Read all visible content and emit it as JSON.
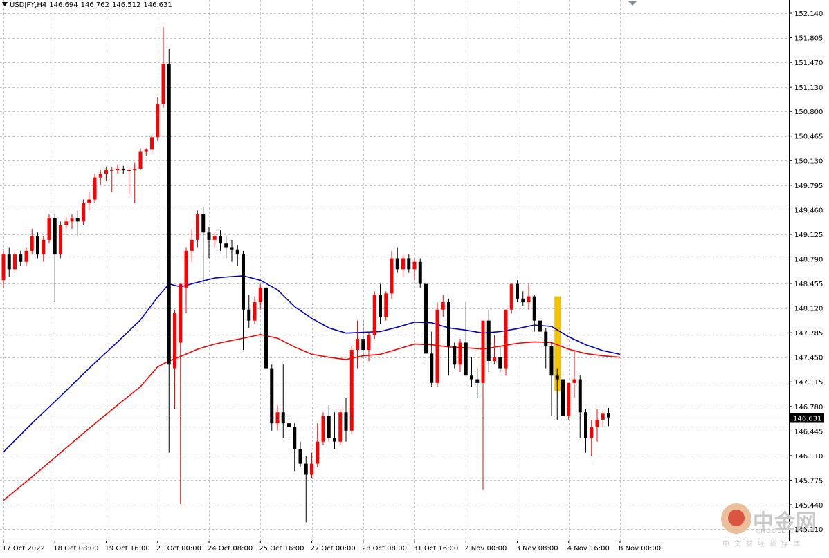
{
  "header": {
    "symbol": "USDJPY,H4",
    "open": "146.694",
    "high": "146.762",
    "low": "146.512",
    "close": "146.631"
  },
  "watermark": {
    "brand_cn": "中金网",
    "brand_en": "CNGOLD.COM",
    "tagline": "中文财经新媒体"
  },
  "chart_data": {
    "type": "candlestick",
    "symbol": "USDJPY",
    "timeframe": "H4",
    "y_range": [
      145.11,
      152.14
    ],
    "y_ticks": [
      "152.140",
      "151.805",
      "151.470",
      "151.130",
      "150.800",
      "150.465",
      "150.130",
      "149.795",
      "149.460",
      "149.125",
      "148.790",
      "148.455",
      "148.120",
      "147.785",
      "147.450",
      "147.115",
      "146.780",
      "146.445",
      "146.110",
      "145.775",
      "145.440",
      "145.110"
    ],
    "x_tick_labels": [
      {
        "bar": 0,
        "label": "17 Oct 2022"
      },
      {
        "bar": 9,
        "label": "18 Oct 08:00"
      },
      {
        "bar": 18,
        "label": "19 Oct 16:00"
      },
      {
        "bar": 27,
        "label": "21 Oct 00:00"
      },
      {
        "bar": 36,
        "label": "24 Oct 08:00"
      },
      {
        "bar": 45,
        "label": "25 Oct 16:00"
      },
      {
        "bar": 54,
        "label": "27 Oct 00:00"
      },
      {
        "bar": 63,
        "label": "28 Oct 08:00"
      },
      {
        "bar": 72,
        "label": "31 Oct 16:00"
      },
      {
        "bar": 81,
        "label": "2 Nov 00:00"
      },
      {
        "bar": 90,
        "label": "3 Nov 08:00"
      },
      {
        "bar": 99,
        "label": "4 Nov 16:00"
      },
      {
        "bar": 108,
        "label": "8 Nov 00:00"
      }
    ],
    "current_price": "146.631",
    "colors": {
      "bull": "#ff0000",
      "bear": "#000000",
      "ma_fast": "#ff0000",
      "ma_slow": "#0000cc",
      "highlight": "#f2c200",
      "price_tag": "#000000"
    },
    "highlight_bar": 97,
    "highlight_range": [
      146.99,
      148.28
    ],
    "candles": [
      [
        148.5,
        148.9,
        148.4,
        148.85
      ],
      [
        148.85,
        148.95,
        148.55,
        148.65
      ],
      [
        148.65,
        148.9,
        148.6,
        148.85
      ],
      [
        148.85,
        148.9,
        148.7,
        148.75
      ],
      [
        148.75,
        148.95,
        148.7,
        148.9
      ],
      [
        148.9,
        149.2,
        148.85,
        149.1
      ],
      [
        149.1,
        149.15,
        148.8,
        148.85
      ],
      [
        148.85,
        149.1,
        148.75,
        149.05
      ],
      [
        149.05,
        149.4,
        149.0,
        149.35
      ],
      [
        149.35,
        149.4,
        148.2,
        148.85
      ],
      [
        148.85,
        149.3,
        148.8,
        149.25
      ],
      [
        149.25,
        149.35,
        149.2,
        149.3
      ],
      [
        149.3,
        149.4,
        149.2,
        149.35
      ],
      [
        149.35,
        149.45,
        149.1,
        149.3
      ],
      [
        149.3,
        149.6,
        149.25,
        149.55
      ],
      [
        149.55,
        149.7,
        149.45,
        149.6
      ],
      [
        149.6,
        149.95,
        149.55,
        149.9
      ],
      [
        149.9,
        150.0,
        149.8,
        149.95
      ],
      [
        149.95,
        150.05,
        149.85,
        150.0
      ],
      [
        150.0,
        150.05,
        149.7,
        150.0
      ],
      [
        150.0,
        150.08,
        149.95,
        150.02
      ],
      [
        150.02,
        150.06,
        149.95,
        150.0
      ],
      [
        150.0,
        150.05,
        149.65,
        150.0
      ],
      [
        150.0,
        150.1,
        149.55,
        150.02
      ],
      [
        150.02,
        150.3,
        150.0,
        150.25
      ],
      [
        150.25,
        150.3,
        150.2,
        150.28
      ],
      [
        150.28,
        150.5,
        150.25,
        150.45
      ],
      [
        150.45,
        151.0,
        150.4,
        150.9
      ],
      [
        150.9,
        151.95,
        150.85,
        151.45
      ],
      [
        151.45,
        151.65,
        146.15,
        147.35
      ],
      [
        147.3,
        148.1,
        146.75,
        148.05
      ],
      [
        147.65,
        148.4,
        145.45,
        148.45
      ],
      [
        148.4,
        148.95,
        148.05,
        148.9
      ],
      [
        148.9,
        149.2,
        148.75,
        149.05
      ],
      [
        149.05,
        149.45,
        148.95,
        149.4
      ],
      [
        149.4,
        149.5,
        148.45,
        149.15
      ],
      [
        149.15,
        149.22,
        148.8,
        149.05
      ],
      [
        149.05,
        149.15,
        148.95,
        149.1
      ],
      [
        149.1,
        149.18,
        148.9,
        149.0
      ],
      [
        149.0,
        149.1,
        148.8,
        148.95
      ],
      [
        148.95,
        149.05,
        148.75,
        148.92
      ],
      [
        148.92,
        148.98,
        148.7,
        148.85
      ],
      [
        148.85,
        148.9,
        147.55,
        148.1
      ],
      [
        148.1,
        148.3,
        147.85,
        147.95
      ],
      [
        147.95,
        148.28,
        147.9,
        148.2
      ],
      [
        148.2,
        148.45,
        148.1,
        148.4
      ],
      [
        148.4,
        148.45,
        146.9,
        147.3
      ],
      [
        147.3,
        147.35,
        146.45,
        146.55
      ],
      [
        146.55,
        146.8,
        146.45,
        146.7
      ],
      [
        146.7,
        147.35,
        146.35,
        146.55
      ],
      [
        146.55,
        146.6,
        146.3,
        146.5
      ],
      [
        146.5,
        146.55,
        145.9,
        146.2
      ],
      [
        146.2,
        146.3,
        145.95,
        146.0
      ],
      [
        146.0,
        146.1,
        145.2,
        145.85
      ],
      [
        145.85,
        146.15,
        145.8,
        146.0
      ],
      [
        146.0,
        146.55,
        145.95,
        146.3
      ],
      [
        146.3,
        146.7,
        146.25,
        146.65
      ],
      [
        146.65,
        146.8,
        146.3,
        146.35
      ],
      [
        146.35,
        146.7,
        146.2,
        146.3
      ],
      [
        146.3,
        146.75,
        146.25,
        146.7
      ],
      [
        146.7,
        146.9,
        146.3,
        146.45
      ],
      [
        146.45,
        147.6,
        146.4,
        147.55
      ],
      [
        147.55,
        147.95,
        147.3,
        147.7
      ],
      [
        147.7,
        147.95,
        147.45,
        147.55
      ],
      [
        147.55,
        147.8,
        147.4,
        147.75
      ],
      [
        147.75,
        148.35,
        147.7,
        148.3
      ],
      [
        148.3,
        148.45,
        147.9,
        148.0
      ],
      [
        148.0,
        148.35,
        147.95,
        148.32
      ],
      [
        148.32,
        148.9,
        148.25,
        148.8
      ],
      [
        148.8,
        148.95,
        148.6,
        148.65
      ],
      [
        148.65,
        148.85,
        148.55,
        148.8
      ],
      [
        148.8,
        148.85,
        148.6,
        148.65
      ],
      [
        148.65,
        148.8,
        148.5,
        148.75
      ],
      [
        148.75,
        148.8,
        148.4,
        148.45
      ],
      [
        148.45,
        148.5,
        147.4,
        147.5
      ],
      [
        147.5,
        147.8,
        147.05,
        147.1
      ],
      [
        147.1,
        148.2,
        147.05,
        148.1
      ],
      [
        148.1,
        148.3,
        148.0,
        148.2
      ],
      [
        148.2,
        148.25,
        147.2,
        147.6
      ],
      [
        147.6,
        147.65,
        147.3,
        147.35
      ],
      [
        147.35,
        147.7,
        147.25,
        147.65
      ],
      [
        147.65,
        148.2,
        147.55,
        147.2
      ],
      [
        147.2,
        147.45,
        147.05,
        147.15
      ],
      [
        147.15,
        147.3,
        146.9,
        147.1
      ],
      [
        147.1,
        147.9,
        145.65,
        147.95
      ],
      [
        147.95,
        148.1,
        147.25,
        147.4
      ],
      [
        147.4,
        147.75,
        147.35,
        147.45
      ],
      [
        147.45,
        147.6,
        147.25,
        147.3
      ],
      [
        147.3,
        148.1,
        147.2,
        148.1
      ],
      [
        148.1,
        148.45,
        148.05,
        148.45
      ],
      [
        148.45,
        148.5,
        148.2,
        148.25
      ],
      [
        148.25,
        148.35,
        148.15,
        148.2
      ],
      [
        148.2,
        148.45,
        148.1,
        148.28
      ],
      [
        148.28,
        148.3,
        147.8,
        147.95
      ],
      [
        147.95,
        148.1,
        147.6,
        147.8
      ],
      [
        147.8,
        147.85,
        147.3,
        147.6
      ],
      [
        147.6,
        147.65,
        146.65,
        147.2
      ],
      [
        147.2,
        147.3,
        146.6,
        147.15
      ],
      [
        147.15,
        147.2,
        146.55,
        146.65
      ],
      [
        146.65,
        147.1,
        146.6,
        147.1
      ],
      [
        147.1,
        147.55,
        146.9,
        147.15
      ],
      [
        147.15,
        147.2,
        146.35,
        146.7
      ],
      [
        146.7,
        146.75,
        146.15,
        146.35
      ],
      [
        146.35,
        146.6,
        146.1,
        146.5
      ],
      [
        146.5,
        146.75,
        146.3,
        146.6
      ],
      [
        146.6,
        146.72,
        146.5,
        146.68
      ],
      [
        146.69,
        146.76,
        146.51,
        146.63
      ]
    ],
    "ma_slow": [
      [
        0,
        146.16
      ],
      [
        5,
        146.55
      ],
      [
        10,
        146.92
      ],
      [
        15,
        147.3
      ],
      [
        20,
        147.66
      ],
      [
        24,
        147.96
      ],
      [
        27,
        148.27
      ],
      [
        29,
        148.45
      ],
      [
        31,
        148.41
      ],
      [
        34,
        148.47
      ],
      [
        37,
        148.53
      ],
      [
        40,
        148.55
      ],
      [
        42,
        148.56
      ],
      [
        45,
        148.5
      ],
      [
        48,
        148.37
      ],
      [
        51,
        148.14
      ],
      [
        54,
        147.98
      ],
      [
        57,
        147.85
      ],
      [
        60,
        147.78
      ],
      [
        63,
        147.79
      ],
      [
        66,
        147.8
      ],
      [
        69,
        147.86
      ],
      [
        72,
        147.93
      ],
      [
        75,
        147.92
      ],
      [
        78,
        147.85
      ],
      [
        81,
        147.82
      ],
      [
        84,
        147.78
      ],
      [
        87,
        147.8
      ],
      [
        90,
        147.84
      ],
      [
        93,
        147.89
      ],
      [
        96,
        147.87
      ],
      [
        99,
        147.73
      ],
      [
        102,
        147.62
      ],
      [
        105,
        147.54
      ],
      [
        108,
        147.49
      ]
    ],
    "ma_fast": [
      [
        0,
        145.5
      ],
      [
        5,
        145.82
      ],
      [
        10,
        146.15
      ],
      [
        15,
        146.48
      ],
      [
        20,
        146.8
      ],
      [
        24,
        147.05
      ],
      [
        27,
        147.32
      ],
      [
        29,
        147.4
      ],
      [
        31,
        147.46
      ],
      [
        34,
        147.56
      ],
      [
        37,
        147.63
      ],
      [
        40,
        147.68
      ],
      [
        42,
        147.71
      ],
      [
        45,
        147.76
      ],
      [
        48,
        147.71
      ],
      [
        51,
        147.59
      ],
      [
        54,
        147.49
      ],
      [
        57,
        147.45
      ],
      [
        60,
        147.42
      ],
      [
        63,
        147.47
      ],
      [
        66,
        147.49
      ],
      [
        69,
        147.56
      ],
      [
        72,
        147.63
      ],
      [
        75,
        147.62
      ],
      [
        78,
        147.59
      ],
      [
        81,
        147.58
      ],
      [
        84,
        147.56
      ],
      [
        87,
        147.6
      ],
      [
        90,
        147.64
      ],
      [
        93,
        147.66
      ],
      [
        96,
        147.65
      ],
      [
        99,
        147.56
      ],
      [
        102,
        147.5
      ],
      [
        105,
        147.47
      ],
      [
        108,
        147.45
      ]
    ]
  }
}
